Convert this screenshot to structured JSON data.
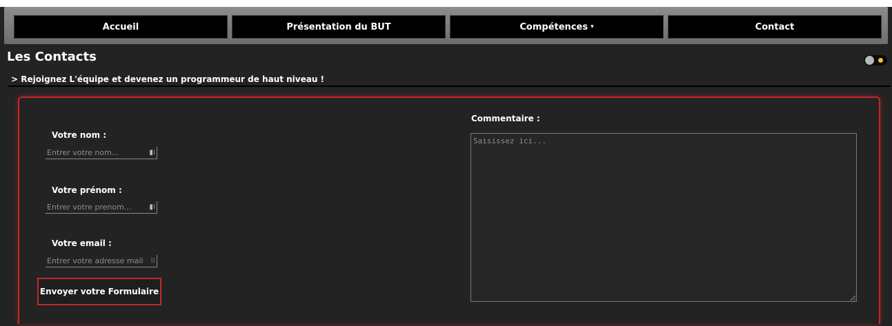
{
  "nav": {
    "items": [
      {
        "label": "Accueil"
      },
      {
        "label": "Présentation du BUT"
      },
      {
        "label": "Compétences",
        "caret": "▾"
      },
      {
        "label": "Contact"
      }
    ]
  },
  "header": {
    "title": "Les Contacts",
    "subtitle": "> Rejoignez L'équipe et devenez un programmeur de haut niveau !",
    "theme_toggle": {
      "icons": [
        "moon-knob-icon",
        "sun-icon"
      ],
      "sun_color": "#f2c21b"
    }
  },
  "form": {
    "name": {
      "label": "Votre nom :",
      "placeholder": "Entrer votre nom..."
    },
    "firstname": {
      "label": "Votre prénom :",
      "placeholder": "Entrer votre prenom..."
    },
    "email": {
      "label": "Votre email :",
      "placeholder": "Entrer votre adresse mail"
    },
    "submit_label": "Envoyer votre Formulaire",
    "comment": {
      "label": "Commentaire :",
      "placeholder": "Saisissez ici..."
    }
  },
  "colors": {
    "accent": "#c62828",
    "background": "#232323",
    "nav_item_bg": "#000000"
  }
}
